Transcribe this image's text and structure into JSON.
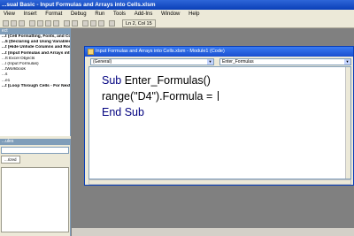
{
  "app": {
    "title": "...sual Basic - Input Formulas and Arrays into Cells.xlsm"
  },
  "menu": [
    "View",
    "Insert",
    "Format",
    "Debug",
    "Run",
    "Tools",
    "Add-Ins",
    "Window",
    "Help"
  ],
  "toolbar": {
    "position": "Ln 2, Col 15"
  },
  "project": {
    "items": [
      {
        "label": "...t (Cell Formatting, Fonts, and Colors",
        "bold": true
      },
      {
        "label": "...5 (Declaring and Using Variables in E",
        "bold": true
      },
      {
        "label": "...t (Hide Unhide Columns and Rows.xl",
        "bold": true
      },
      {
        "label": "...t (Input Formulas and Arrays into C",
        "bold": true
      },
      {
        "label": "...ft Excel Objects",
        "bold": false
      },
      {
        "label": "...l (Input Formulas)",
        "bold": false
      },
      {
        "label": "...tWorkbook",
        "bold": false
      },
      {
        "label": "",
        "bold": false
      },
      {
        "label": "...s",
        "bold": false
      },
      {
        "label": "...e1",
        "bold": false
      },
      {
        "label": "...t (Loop Through Cells - For Next Lo",
        "bold": true
      }
    ]
  },
  "properties": {
    "header": "...ules",
    "tab": "...rized"
  },
  "code_window": {
    "title": "Input Formulas and Arrays into Cells.xlsm - Module1 (Code)",
    "object_combo": "(General)",
    "proc_combo": "Enter_Formulas",
    "line1_kw": "Sub",
    "line1_rest": " Enter_Formulas()",
    "line2": "range(\"D4\").Formula = ",
    "line3": "End Sub"
  }
}
